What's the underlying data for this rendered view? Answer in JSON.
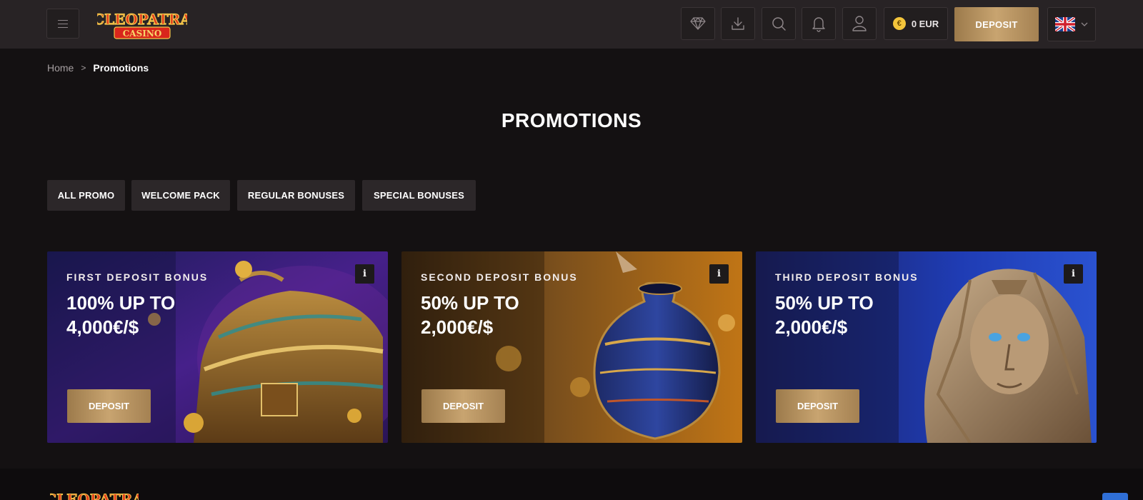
{
  "header": {
    "logo_top": "CLEOPATRA",
    "logo_bottom": "CASINO",
    "balance": "0 EUR",
    "coin_symbol": "€",
    "deposit_label": "DEPOSIT",
    "icons": [
      "menu-icon",
      "diamond-icon",
      "download-icon",
      "search-icon",
      "bell-icon",
      "user-icon",
      "uk-flag-icon",
      "chevron-down-icon"
    ]
  },
  "breadcrumb": {
    "home": "Home",
    "separator": ">",
    "current": "Promotions"
  },
  "page_title": "PROMOTIONS",
  "tabs": [
    {
      "label": "ALL PROMO",
      "active": false
    },
    {
      "label": "WELCOME PACK",
      "active": true
    },
    {
      "label": "REGULAR BONUSES",
      "active": false
    },
    {
      "label": "SPECIAL BONUSES",
      "active": false
    }
  ],
  "cards": [
    {
      "eyebrow": "FIRST DEPOSIT BONUS",
      "headline": "100% UP TO 4,000€/$",
      "deposit": "DEPOSIT",
      "info": "i"
    },
    {
      "eyebrow": "SECOND DEPOSIT BONUS",
      "headline": "50% UP TO 2,000€/$",
      "deposit": "DEPOSIT",
      "info": "i"
    },
    {
      "eyebrow": "THIRD DEPOSIT BONUS",
      "headline": "50% UP TO 2,000€/$",
      "deposit": "DEPOSIT",
      "info": "i"
    }
  ],
  "footer": {
    "logo_text": "CLEOPATRA"
  },
  "colors": {
    "background": "#141112",
    "header": "#282325",
    "gold_accent": "#c8a470",
    "tab_inactive": "#2c2729"
  }
}
